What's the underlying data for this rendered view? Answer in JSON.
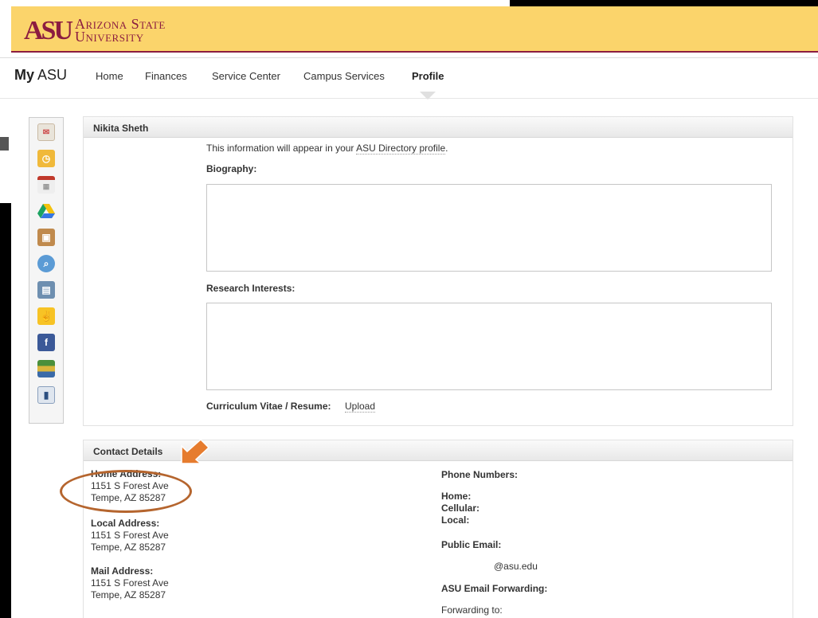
{
  "logo": {
    "mark": "ASU",
    "line1": "Arizona State",
    "line2": "University"
  },
  "nav": {
    "brand_bold": "My",
    "brand_rest": " ASU",
    "items": [
      {
        "label": "Home"
      },
      {
        "label": "Finances"
      },
      {
        "label": "Service Center"
      },
      {
        "label": "Campus Services"
      },
      {
        "label": "Profile"
      }
    ]
  },
  "sidebar": {
    "icons": [
      "email-icon",
      "outlook-icon",
      "calendar-icon",
      "google-drive-icon",
      "package-icon",
      "globe-search-icon",
      "cards-icon",
      "sun-devil-icon",
      "facebook-icon",
      "books-icon",
      "notebook-icon"
    ]
  },
  "profile": {
    "name": "Nikita Sheth",
    "intro_pre": "This information will appear in your ",
    "intro_link": "ASU Directory profile",
    "biography_label": "Biography:",
    "research_label": "Research Interests:",
    "cv_label": "Curriculum Vitae / Resume:",
    "cv_link": "Upload"
  },
  "contact": {
    "title": "Contact Details",
    "home_label": "Home Address:",
    "home_line1": "1151 S Forest Ave",
    "home_line2": "Tempe, AZ 85287",
    "local_label": "Local Address:",
    "local_line1": "1151 S Forest Ave",
    "local_line2": "Tempe, AZ 85287",
    "mail_label": "Mail Address:",
    "mail_line1": "1151 S Forest Ave",
    "mail_line2": "Tempe, AZ 85287",
    "phone_title": "Phone Numbers:",
    "phone_home": "Home:",
    "phone_cell": "Cellular:",
    "phone_local": "Local:",
    "email_title": "Public Email:",
    "email_value": "@asu.edu",
    "fwd_title": "ASU Email Forwarding:",
    "fwd_label": "Forwarding to:"
  },
  "colors": {
    "maroon": "#8c1d40",
    "gold": "#fbd46b",
    "annotation": "#e67c2e"
  }
}
